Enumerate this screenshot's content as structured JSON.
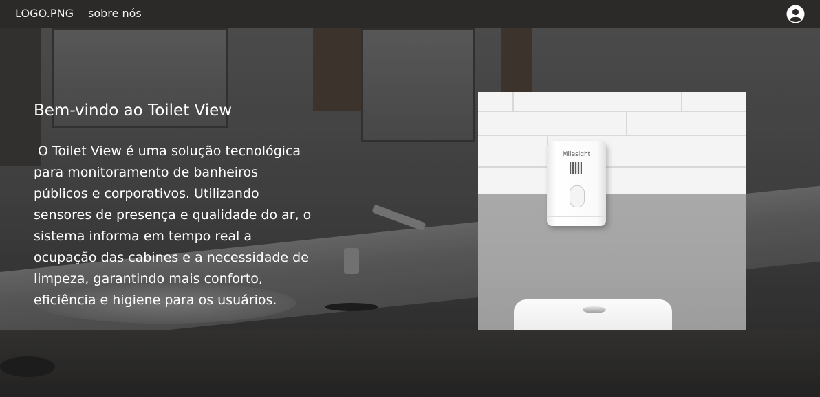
{
  "nav": {
    "logo_text": "LOGO.PNG",
    "about_label": "sobre nós",
    "user_icon": "user-circle-icon"
  },
  "hero": {
    "title": "Bem-vindo ao Toilet View",
    "description": " O Toilet View é uma solução tecnológica para monitoramento de banheiros públicos e corporativos. Utilizando sensores de presença e qualidade do ar, o sistema informa em tempo real a ocupação das cabines e a necessidade de limpeza, garantindo mais conforto, eficiência e higiene para os usuários.",
    "product_image": {
      "brand_text": "Milesight"
    }
  },
  "colors": {
    "navbar_bg": "#2c2a29",
    "nav_text": "#f2f2f2",
    "hero_text": "#ffffff"
  }
}
